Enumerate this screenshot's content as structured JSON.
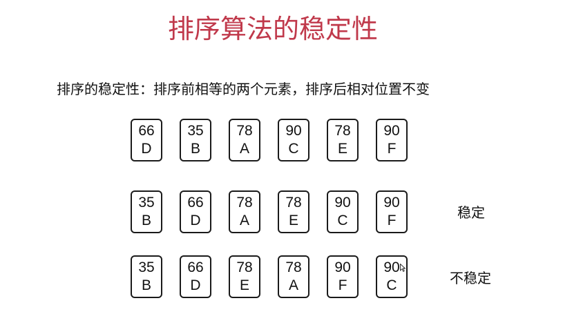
{
  "slide": {
    "title": "排序算法的稳定性",
    "subtitle": "排序的稳定性：排序前相等的两个元素，排序后相对位置不变"
  },
  "rows": [
    {
      "label": "",
      "cards": [
        {
          "num": "66",
          "letter": "D"
        },
        {
          "num": "35",
          "letter": "B"
        },
        {
          "num": "78",
          "letter": "A"
        },
        {
          "num": "90",
          "letter": "C"
        },
        {
          "num": "78",
          "letter": "E"
        },
        {
          "num": "90",
          "letter": "F"
        }
      ]
    },
    {
      "label": "稳定",
      "cards": [
        {
          "num": "35",
          "letter": "B"
        },
        {
          "num": "66",
          "letter": "D"
        },
        {
          "num": "78",
          "letter": "A"
        },
        {
          "num": "78",
          "letter": "E"
        },
        {
          "num": "90",
          "letter": "C"
        },
        {
          "num": "90",
          "letter": "F"
        }
      ]
    },
    {
      "label": "不稳定",
      "cards": [
        {
          "num": "35",
          "letter": "B"
        },
        {
          "num": "66",
          "letter": "D"
        },
        {
          "num": "78",
          "letter": "E"
        },
        {
          "num": "78",
          "letter": "A"
        },
        {
          "num": "90",
          "letter": "F"
        },
        {
          "num": "90",
          "letter": "C"
        }
      ]
    }
  ],
  "pointer": {
    "icon": "mouse-pointer-icon"
  }
}
